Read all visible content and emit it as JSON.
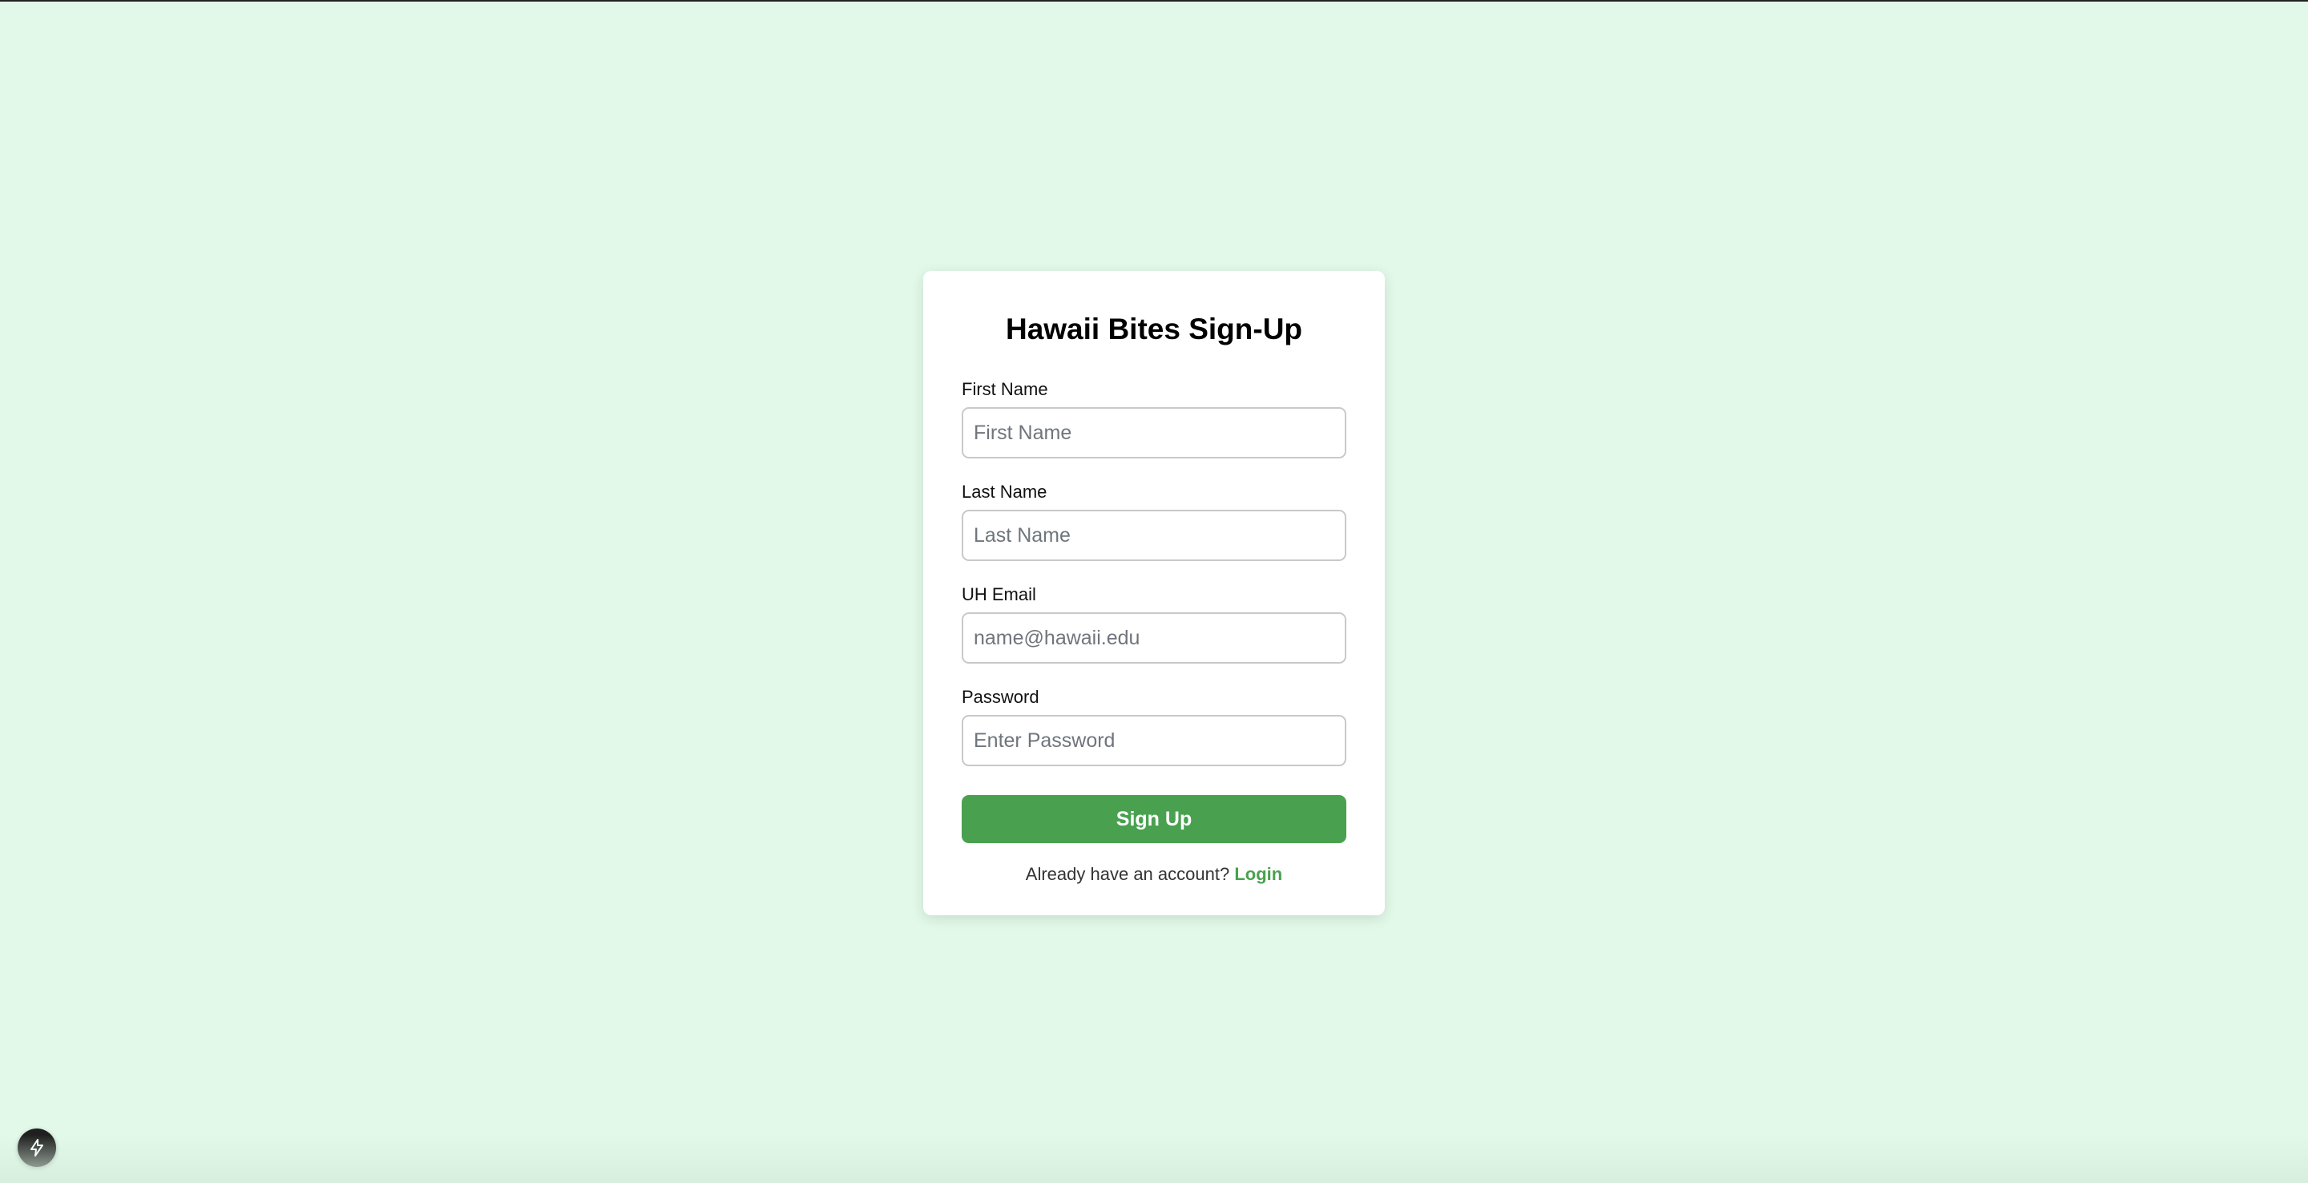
{
  "page": {
    "background_color": "#e2f9e9",
    "accent_color": "#49a150"
  },
  "form": {
    "title": "Hawaii Bites Sign-Up",
    "fields": [
      {
        "label": "First Name",
        "placeholder": "First Name",
        "value": ""
      },
      {
        "label": "Last Name",
        "placeholder": "Last Name",
        "value": ""
      },
      {
        "label": "UH Email",
        "placeholder": "name@hawaii.edu",
        "value": ""
      },
      {
        "label": "Password",
        "placeholder": "Enter Password",
        "value": ""
      }
    ],
    "submit_label": "Sign Up",
    "footer_prompt": "Already have an account?",
    "login_link": "Login"
  },
  "dev_tools": {
    "icon": "lightning-icon"
  }
}
